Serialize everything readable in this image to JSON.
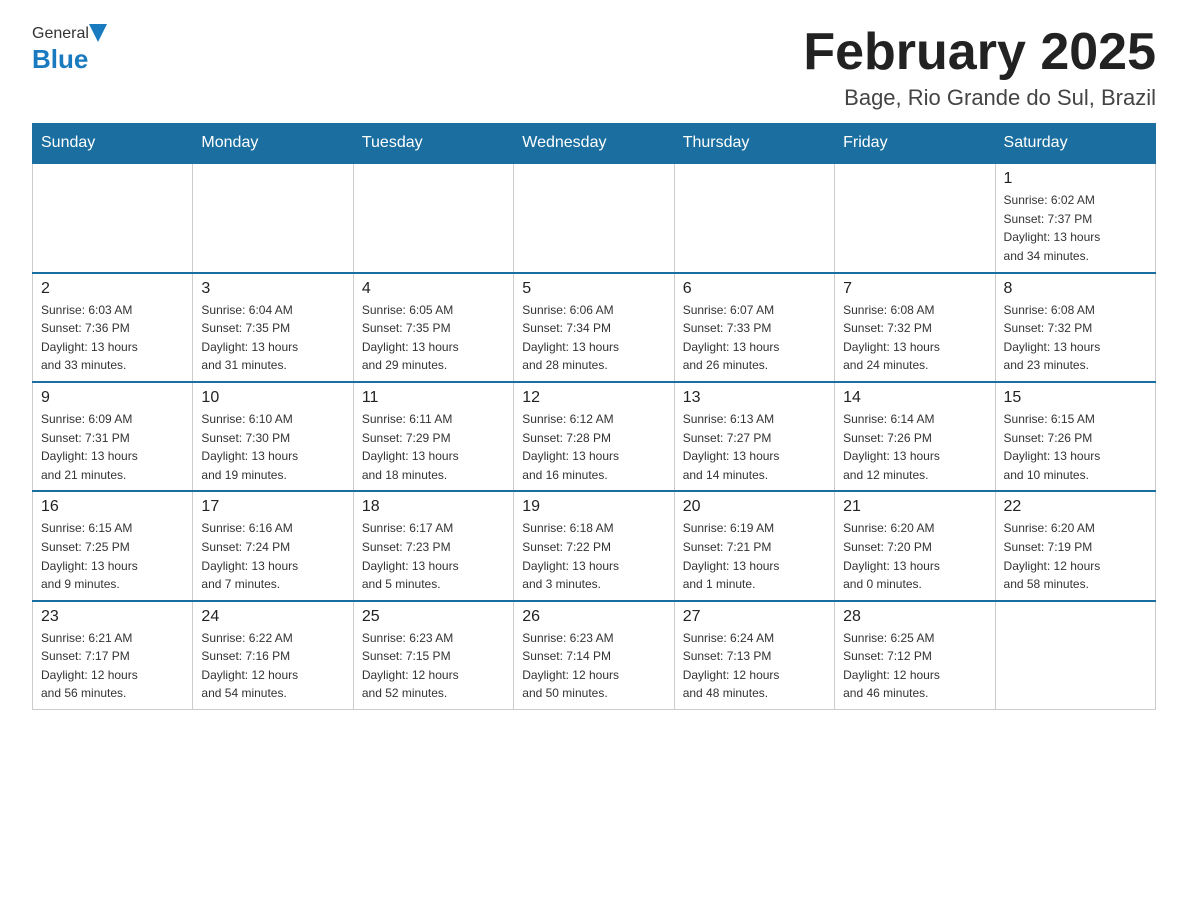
{
  "header": {
    "logo_general": "General",
    "logo_blue": "Blue",
    "month_title": "February 2025",
    "location": "Bage, Rio Grande do Sul, Brazil"
  },
  "weekdays": [
    "Sunday",
    "Monday",
    "Tuesday",
    "Wednesday",
    "Thursday",
    "Friday",
    "Saturday"
  ],
  "weeks": [
    [
      {
        "day": "",
        "info": ""
      },
      {
        "day": "",
        "info": ""
      },
      {
        "day": "",
        "info": ""
      },
      {
        "day": "",
        "info": ""
      },
      {
        "day": "",
        "info": ""
      },
      {
        "day": "",
        "info": ""
      },
      {
        "day": "1",
        "info": "Sunrise: 6:02 AM\nSunset: 7:37 PM\nDaylight: 13 hours\nand 34 minutes."
      }
    ],
    [
      {
        "day": "2",
        "info": "Sunrise: 6:03 AM\nSunset: 7:36 PM\nDaylight: 13 hours\nand 33 minutes."
      },
      {
        "day": "3",
        "info": "Sunrise: 6:04 AM\nSunset: 7:35 PM\nDaylight: 13 hours\nand 31 minutes."
      },
      {
        "day": "4",
        "info": "Sunrise: 6:05 AM\nSunset: 7:35 PM\nDaylight: 13 hours\nand 29 minutes."
      },
      {
        "day": "5",
        "info": "Sunrise: 6:06 AM\nSunset: 7:34 PM\nDaylight: 13 hours\nand 28 minutes."
      },
      {
        "day": "6",
        "info": "Sunrise: 6:07 AM\nSunset: 7:33 PM\nDaylight: 13 hours\nand 26 minutes."
      },
      {
        "day": "7",
        "info": "Sunrise: 6:08 AM\nSunset: 7:32 PM\nDaylight: 13 hours\nand 24 minutes."
      },
      {
        "day": "8",
        "info": "Sunrise: 6:08 AM\nSunset: 7:32 PM\nDaylight: 13 hours\nand 23 minutes."
      }
    ],
    [
      {
        "day": "9",
        "info": "Sunrise: 6:09 AM\nSunset: 7:31 PM\nDaylight: 13 hours\nand 21 minutes."
      },
      {
        "day": "10",
        "info": "Sunrise: 6:10 AM\nSunset: 7:30 PM\nDaylight: 13 hours\nand 19 minutes."
      },
      {
        "day": "11",
        "info": "Sunrise: 6:11 AM\nSunset: 7:29 PM\nDaylight: 13 hours\nand 18 minutes."
      },
      {
        "day": "12",
        "info": "Sunrise: 6:12 AM\nSunset: 7:28 PM\nDaylight: 13 hours\nand 16 minutes."
      },
      {
        "day": "13",
        "info": "Sunrise: 6:13 AM\nSunset: 7:27 PM\nDaylight: 13 hours\nand 14 minutes."
      },
      {
        "day": "14",
        "info": "Sunrise: 6:14 AM\nSunset: 7:26 PM\nDaylight: 13 hours\nand 12 minutes."
      },
      {
        "day": "15",
        "info": "Sunrise: 6:15 AM\nSunset: 7:26 PM\nDaylight: 13 hours\nand 10 minutes."
      }
    ],
    [
      {
        "day": "16",
        "info": "Sunrise: 6:15 AM\nSunset: 7:25 PM\nDaylight: 13 hours\nand 9 minutes."
      },
      {
        "day": "17",
        "info": "Sunrise: 6:16 AM\nSunset: 7:24 PM\nDaylight: 13 hours\nand 7 minutes."
      },
      {
        "day": "18",
        "info": "Sunrise: 6:17 AM\nSunset: 7:23 PM\nDaylight: 13 hours\nand 5 minutes."
      },
      {
        "day": "19",
        "info": "Sunrise: 6:18 AM\nSunset: 7:22 PM\nDaylight: 13 hours\nand 3 minutes."
      },
      {
        "day": "20",
        "info": "Sunrise: 6:19 AM\nSunset: 7:21 PM\nDaylight: 13 hours\nand 1 minute."
      },
      {
        "day": "21",
        "info": "Sunrise: 6:20 AM\nSunset: 7:20 PM\nDaylight: 13 hours\nand 0 minutes."
      },
      {
        "day": "22",
        "info": "Sunrise: 6:20 AM\nSunset: 7:19 PM\nDaylight: 12 hours\nand 58 minutes."
      }
    ],
    [
      {
        "day": "23",
        "info": "Sunrise: 6:21 AM\nSunset: 7:17 PM\nDaylight: 12 hours\nand 56 minutes."
      },
      {
        "day": "24",
        "info": "Sunrise: 6:22 AM\nSunset: 7:16 PM\nDaylight: 12 hours\nand 54 minutes."
      },
      {
        "day": "25",
        "info": "Sunrise: 6:23 AM\nSunset: 7:15 PM\nDaylight: 12 hours\nand 52 minutes."
      },
      {
        "day": "26",
        "info": "Sunrise: 6:23 AM\nSunset: 7:14 PM\nDaylight: 12 hours\nand 50 minutes."
      },
      {
        "day": "27",
        "info": "Sunrise: 6:24 AM\nSunset: 7:13 PM\nDaylight: 12 hours\nand 48 minutes."
      },
      {
        "day": "28",
        "info": "Sunrise: 6:25 AM\nSunset: 7:12 PM\nDaylight: 12 hours\nand 46 minutes."
      },
      {
        "day": "",
        "info": ""
      }
    ]
  ]
}
